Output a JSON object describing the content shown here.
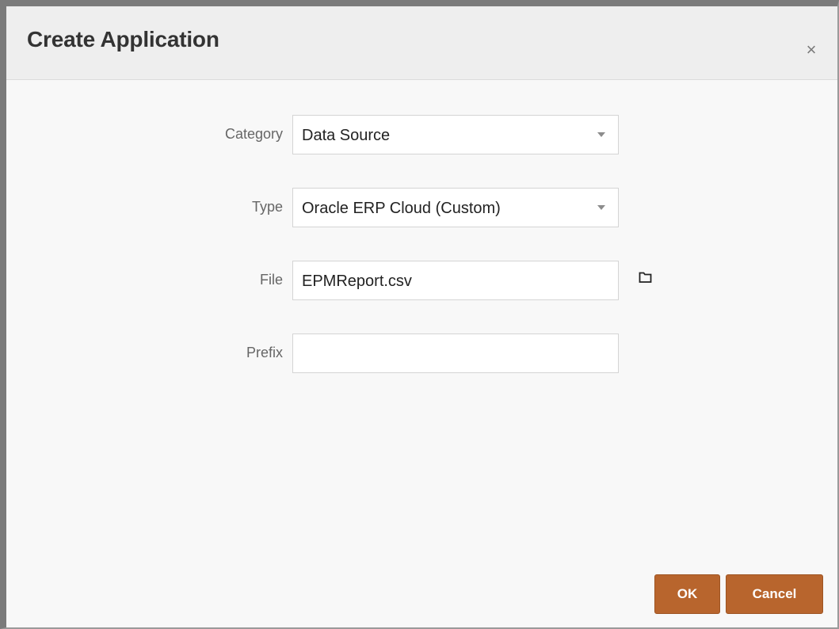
{
  "dialog": {
    "title": "Create Application",
    "close_symbol": "×"
  },
  "form": {
    "category": {
      "label": "Category",
      "value": "Data Source"
    },
    "type": {
      "label": "Type",
      "value": "Oracle ERP Cloud (Custom)"
    },
    "file": {
      "label": "File",
      "value": "EPMReport.csv",
      "browse_icon": "folder-icon"
    },
    "prefix": {
      "label": "Prefix",
      "value": ""
    }
  },
  "buttons": {
    "ok": "OK",
    "cancel": "Cancel"
  },
  "colors": {
    "button_bg": "#b8652d",
    "header_bg": "#eeeeee",
    "body_bg": "#f8f8f8"
  }
}
